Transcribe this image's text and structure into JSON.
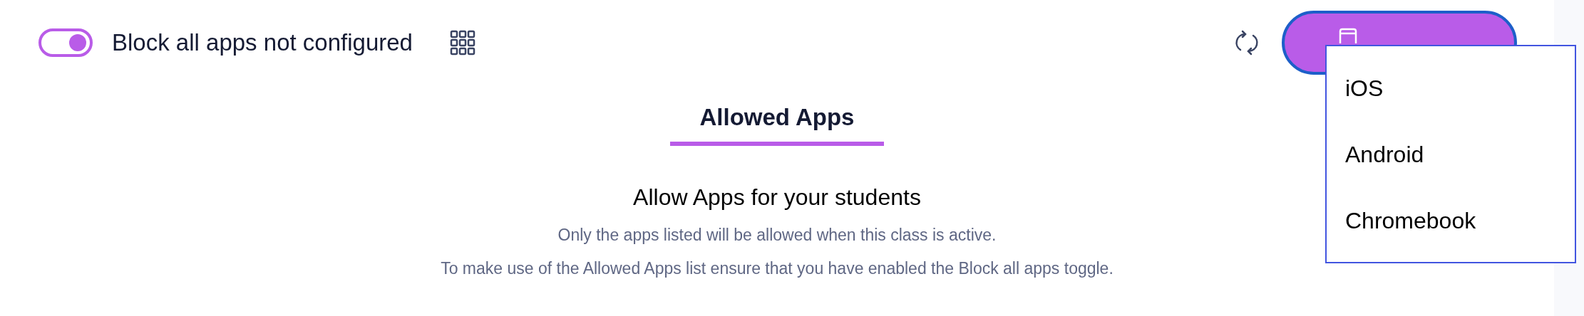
{
  "block_toggle": {
    "label": "Block all apps not configured",
    "on": true
  },
  "menu": {
    "items": [
      {
        "label": "iOS"
      },
      {
        "label": "Android"
      },
      {
        "label": "Chromebook"
      }
    ]
  },
  "tabs": [
    {
      "label": "Allowed Apps",
      "selected": true
    }
  ],
  "empty_state": {
    "title": "Allow Apps for your students",
    "lines": [
      "Only the apps listed will be allowed when this class is active.",
      "To make use of the Allowed Apps list ensure that you have enabled the Block all apps toggle."
    ]
  }
}
